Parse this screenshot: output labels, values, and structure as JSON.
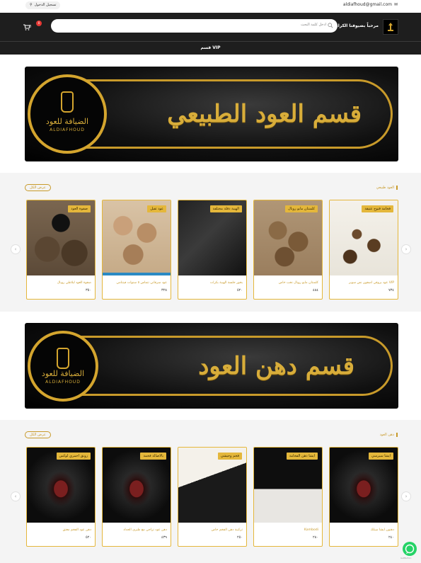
{
  "topbar": {
    "login_label": "تسجيل الدخول",
    "email": "aldiafhoud@gmail.com"
  },
  "header": {
    "welcome": "مرحباً بضيوفنا الكرام",
    "search_placeholder": "ادخل كلمة البحث",
    "cart_count": "0",
    "cart_amount": "0"
  },
  "nav": {
    "item": "قسم VIP"
  },
  "banners": [
    {
      "title": "قسم العود الطبيعي",
      "logo_ar": "الضيافة للعود",
      "logo_en": "ALDIAFHOUD"
    },
    {
      "title": "قسم دهن العود",
      "logo_ar": "الضيافة للعود",
      "logo_en": "ALDIAFHOUD"
    }
  ],
  "sections": [
    {
      "title": "العود طبيعي",
      "more": "عرض الكل",
      "products": [
        {
          "badge": "فخامة قنوح عتيقة",
          "name": "عود بروقي اصفون نص سوبر VIP",
          "price": "٧٣٤",
          "img": "dark-chips"
        },
        {
          "badge": "كلمنتان مايو رويال",
          "name": "كلمنتان مايو رويال نخب خاص",
          "price": "٤٨٤",
          "img": "brown-chips"
        },
        {
          "badge": "الهيبة دفلة مختلفة",
          "name": "بخور جلسة الهيبة بكرات",
          "price": "٥٢٠",
          "img": "gift-box"
        },
        {
          "badge": "عود ثقيل",
          "name": "عود سرقاني تنماس ٥ سنوات فيتنامي",
          "price": "٣٢٨",
          "img": "light-chips"
        },
        {
          "badge": "صفوة العود",
          "name": "صفوة العود لبلاطي رويال",
          "price": "٣٥٠",
          "img": "logo-chips"
        }
      ]
    },
    {
      "title": "دهن العود",
      "more": "عرض الكل",
      "products": [
        {
          "badge": "ايشا سيرسي",
          "name": "دهنون ايشا سيلك",
          "price": "٢٤٠",
          "img": "oil-red"
        },
        {
          "badge": "ايشا دهن الفخامة",
          "name": "Kambodi",
          "price": "٢٨٠",
          "img": "oil-box"
        },
        {
          "badge": "فخم وحيشي",
          "name": "تركيبة دهن الفخم خاص",
          "price": "٢٥٠",
          "img": "oil-black"
        },
        {
          "badge": "بالاصالة فخمة",
          "name": "دهن عود تراجي مع طيري الحداد",
          "price": "٤٣٩",
          "img": "oil-red"
        },
        {
          "badge": "رونق احمري لوكس",
          "name": "دهن عود الفخم معتق",
          "price": "٥٢٠",
          "img": "oil-red"
        }
      ]
    }
  ],
  "whatsapp": {
    "label": "GetButton"
  },
  "colors": {
    "gold": "#c89a2a",
    "header": "#1e1e1e",
    "badge": "#e4b73b"
  }
}
